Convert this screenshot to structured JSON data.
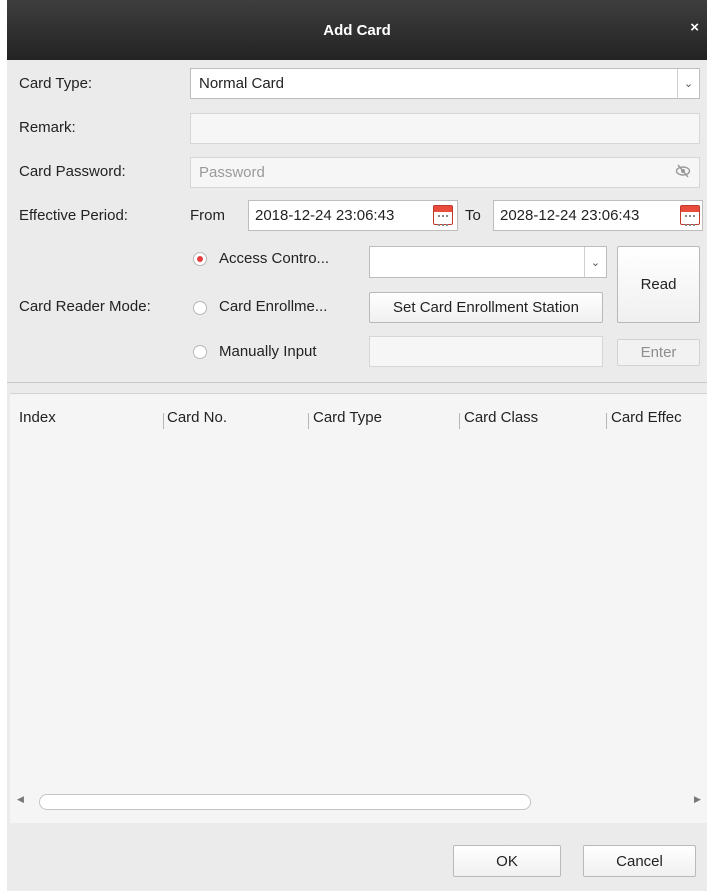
{
  "title": "Add Card",
  "close_label": "×",
  "form": {
    "card_type_label": "Card Type:",
    "card_type_value": "Normal Card",
    "remark_label": "Remark:",
    "remark_value": "",
    "card_password_label": "Card Password:",
    "card_password_placeholder": "Password",
    "effective_period_label": "Effective Period:",
    "from_label": "From",
    "from_value": "2018-12-24 23:06:43",
    "to_label": "To",
    "to_value": "2028-12-24 23:06:43",
    "card_reader_mode_label": "Card Reader Mode:",
    "modes": [
      {
        "label": "Access Contro...",
        "selected": true
      },
      {
        "label": "Card Enrollme...",
        "selected": false
      },
      {
        "label": "Manually Input",
        "selected": false
      }
    ],
    "access_control_select_value": "",
    "set_station_button": "Set Card Enrollment Station",
    "read_button": "Read",
    "manual_input_value": "",
    "enter_button": "Enter"
  },
  "table": {
    "columns": [
      "Index",
      "Card No.",
      "Card Type",
      "Card Class",
      "Card Effec"
    ],
    "rows": []
  },
  "footer": {
    "ok_button": "OK",
    "cancel_button": "Cancel"
  },
  "colors": {
    "titlebar": "#2b2b2b",
    "radio_selected": "#e43e3e",
    "background": "#ebebeb"
  }
}
